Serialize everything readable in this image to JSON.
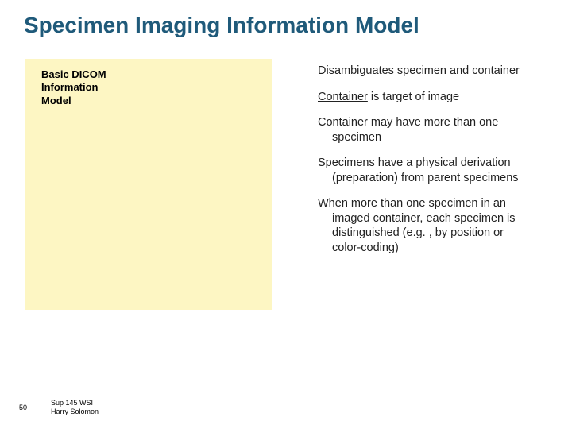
{
  "title": "Specimen Imaging Information Model",
  "box": {
    "label_line1": "Basic DICOM",
    "label_line2": "Information",
    "label_line3": "Model"
  },
  "bullets": {
    "b1a": "Disambiguates specimen and container",
    "b2_underline": "Container",
    "b2_rest": " is target of image",
    "b3": "Container may have more than one specimen",
    "b4": "Specimens have a physical derivation (preparation) from parent specimens",
    "b5": "When more than one specimen in an imaged container, each specimen is distinguished (e.g. , by position or color-coding)"
  },
  "footer": {
    "page": "50",
    "line1": "Sup 145 WSI",
    "line2": "Harry Solomon"
  }
}
